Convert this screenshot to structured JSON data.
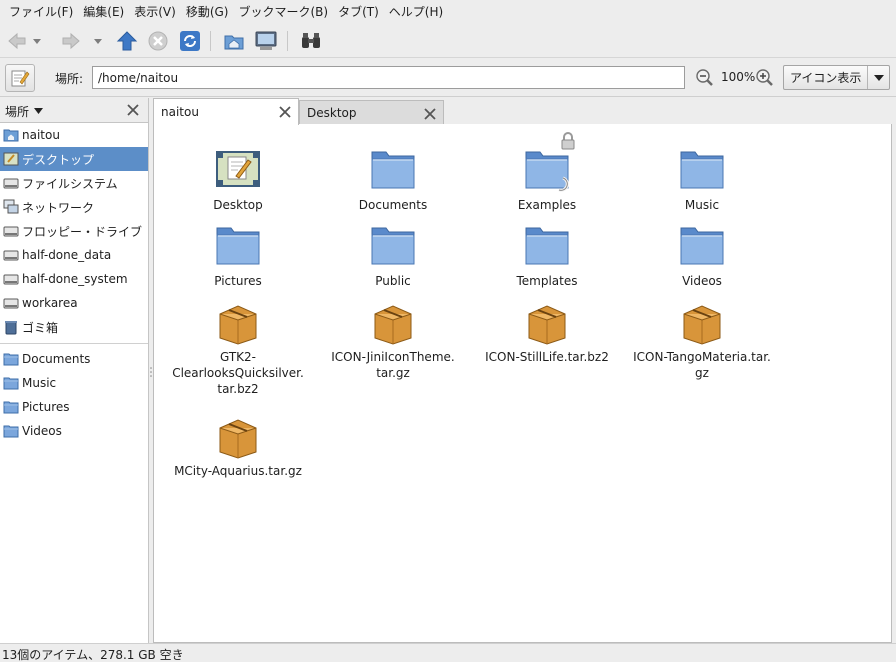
{
  "menubar": {
    "items": [
      "ファイル(F)",
      "編集(E)",
      "表示(V)",
      "移動(G)",
      "ブックマーク(B)",
      "タブ(T)",
      "ヘルプ(H)"
    ]
  },
  "toolbar": {
    "buttons": [
      "back-icon",
      "back-history-icon",
      "forward-icon",
      "forward-history-icon",
      "up-icon",
      "stop-icon",
      "reload-icon",
      "home-icon",
      "computer-icon",
      "search-icon"
    ]
  },
  "location": {
    "label": "場所:",
    "path": "/home/naitou",
    "zoom": "100%",
    "view_mode": "アイコン表示"
  },
  "sidebar": {
    "header": "場所",
    "places": [
      {
        "label": "naitou",
        "icon": "home-folder-icon"
      },
      {
        "label": "デスクトップ",
        "icon": "desktop-icon",
        "selected": true
      },
      {
        "label": "ファイルシステム",
        "icon": "drive-icon"
      },
      {
        "label": "ネットワーク",
        "icon": "network-icon"
      },
      {
        "label": "フロッピー・ドライブ",
        "icon": "drive-icon"
      },
      {
        "label": "half-done_data",
        "icon": "drive-icon"
      },
      {
        "label": "half-done_system",
        "icon": "drive-icon"
      },
      {
        "label": "workarea",
        "icon": "drive-icon"
      },
      {
        "label": "ゴミ箱",
        "icon": "trash-icon"
      }
    ],
    "bookmarks": [
      {
        "label": "Documents",
        "icon": "folder-icon"
      },
      {
        "label": "Music",
        "icon": "folder-icon"
      },
      {
        "label": "Pictures",
        "icon": "folder-icon"
      },
      {
        "label": "Videos",
        "icon": "folder-icon"
      }
    ]
  },
  "tabs": [
    {
      "label": "naitou",
      "active": true
    },
    {
      "label": "Desktop",
      "active": false
    }
  ],
  "files": [
    {
      "name": "Desktop",
      "type": "desktop"
    },
    {
      "name": "Documents",
      "type": "folder"
    },
    {
      "name": "Examples",
      "type": "folder-link-locked"
    },
    {
      "name": "Music",
      "type": "folder"
    },
    {
      "name": "Pictures",
      "type": "folder"
    },
    {
      "name": "Public",
      "type": "folder"
    },
    {
      "name": "Templates",
      "type": "folder"
    },
    {
      "name": "Videos",
      "type": "folder"
    },
    {
      "name": "GTK2-\nClearlooksQuicksilver.\ntar.bz2",
      "type": "archive"
    },
    {
      "name": "ICON-JiniIconTheme.\ntar.gz",
      "type": "archive"
    },
    {
      "name": "ICON-StillLife.tar.bz2",
      "type": "archive"
    },
    {
      "name": "ICON-TangoMateria.tar.\ngz",
      "type": "archive"
    },
    {
      "name": "MCity-Aquarius.tar.gz",
      "type": "archive"
    }
  ],
  "status": {
    "text": "13個のアイテム、278.1 GB 空き"
  },
  "colors": {
    "selection": "#5c8ec8",
    "folder": "#7ba6dc",
    "archive": "#d9963a"
  }
}
